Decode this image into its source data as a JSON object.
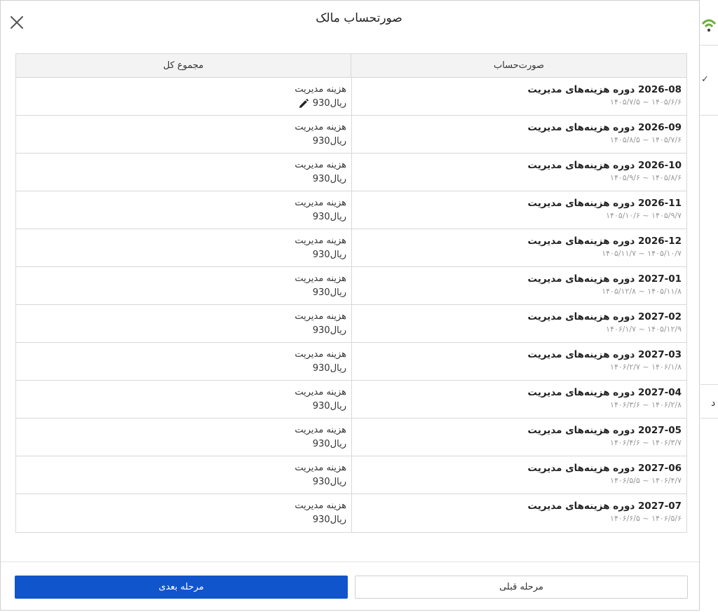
{
  "dialog": {
    "title": "صورتحساب مالک",
    "close_icon": "close-icon"
  },
  "table": {
    "headers": {
      "invoice": "صورت‌حساب",
      "total": "مجموع کل"
    },
    "rows": [
      {
        "title": "2026-08 دوره هزینه‌های مدیریت",
        "range": "۱۴۰۵/۶/۶ ~ ۱۴۰۵/۷/۵",
        "fee_label": "هزینه مدیریت",
        "amount": "ریال930",
        "editable": true
      },
      {
        "title": "2026-09 دوره هزینه‌های مدیریت",
        "range": "۱۴۰۵/۷/۶ ~ ۱۴۰۵/۸/۵",
        "fee_label": "هزینه مدیریت",
        "amount": "ریال930",
        "editable": false
      },
      {
        "title": "2026-10 دوره هزینه‌های مدیریت",
        "range": "۱۴۰۵/۸/۶ ~ ۱۴۰۵/۹/۶",
        "fee_label": "هزینه مدیریت",
        "amount": "ریال930",
        "editable": false
      },
      {
        "title": "2026-11 دوره هزینه‌های مدیریت",
        "range": "۱۴۰۵/۹/۷ ~ ۱۴۰۵/۱۰/۶",
        "fee_label": "هزینه مدیریت",
        "amount": "ریال930",
        "editable": false
      },
      {
        "title": "2026-12 دوره هزینه‌های مدیریت",
        "range": "۱۴۰۵/۱۰/۷ ~ ۱۴۰۵/۱۱/۷",
        "fee_label": "هزینه مدیریت",
        "amount": "ریال930",
        "editable": false
      },
      {
        "title": "2027-01 دوره هزینه‌های مدیریت",
        "range": "۱۴۰۵/۱۱/۸ ~ ۱۴۰۵/۱۲/۸",
        "fee_label": "هزینه مدیریت",
        "amount": "ریال930",
        "editable": false
      },
      {
        "title": "2027-02 دوره هزینه‌های مدیریت",
        "range": "۱۴۰۵/۱۲/۹ ~ ۱۴۰۶/۱/۷",
        "fee_label": "هزینه مدیریت",
        "amount": "ریال930",
        "editable": false
      },
      {
        "title": "2027-03 دوره هزینه‌های مدیریت",
        "range": "۱۴۰۶/۱/۸ ~ ۱۴۰۶/۲/۷",
        "fee_label": "هزینه مدیریت",
        "amount": "ریال930",
        "editable": false
      },
      {
        "title": "2027-04 دوره هزینه‌های مدیریت",
        "range": "۱۴۰۶/۲/۸ ~ ۱۴۰۶/۳/۶",
        "fee_label": "هزینه مدیریت",
        "amount": "ریال930",
        "editable": false
      },
      {
        "title": "2027-05 دوره هزینه‌های مدیریت",
        "range": "۱۴۰۶/۳/۷ ~ ۱۴۰۶/۴/۶",
        "fee_label": "هزینه مدیریت",
        "amount": "ریال930",
        "editable": false
      },
      {
        "title": "2027-06 دوره هزینه‌های مدیریت",
        "range": "۱۴۰۶/۴/۷ ~ ۱۴۰۶/۵/۵",
        "fee_label": "هزینه مدیریت",
        "amount": "ریال930",
        "editable": false
      },
      {
        "title": "2027-07 دوره هزینه‌های مدیریت",
        "range": "۱۴۰۶/۵/۶ ~ ۱۴۰۶/۶/۵",
        "fee_label": "هزینه مدیریت",
        "amount": "ریال930",
        "editable": false
      }
    ]
  },
  "footer": {
    "next_label": "مرحله بعدی",
    "prev_label": "مرحله قبلی"
  },
  "background": {
    "glyph": "د"
  },
  "colors": {
    "primary": "#1155cc",
    "wifi_icon": "#6aae3a"
  }
}
